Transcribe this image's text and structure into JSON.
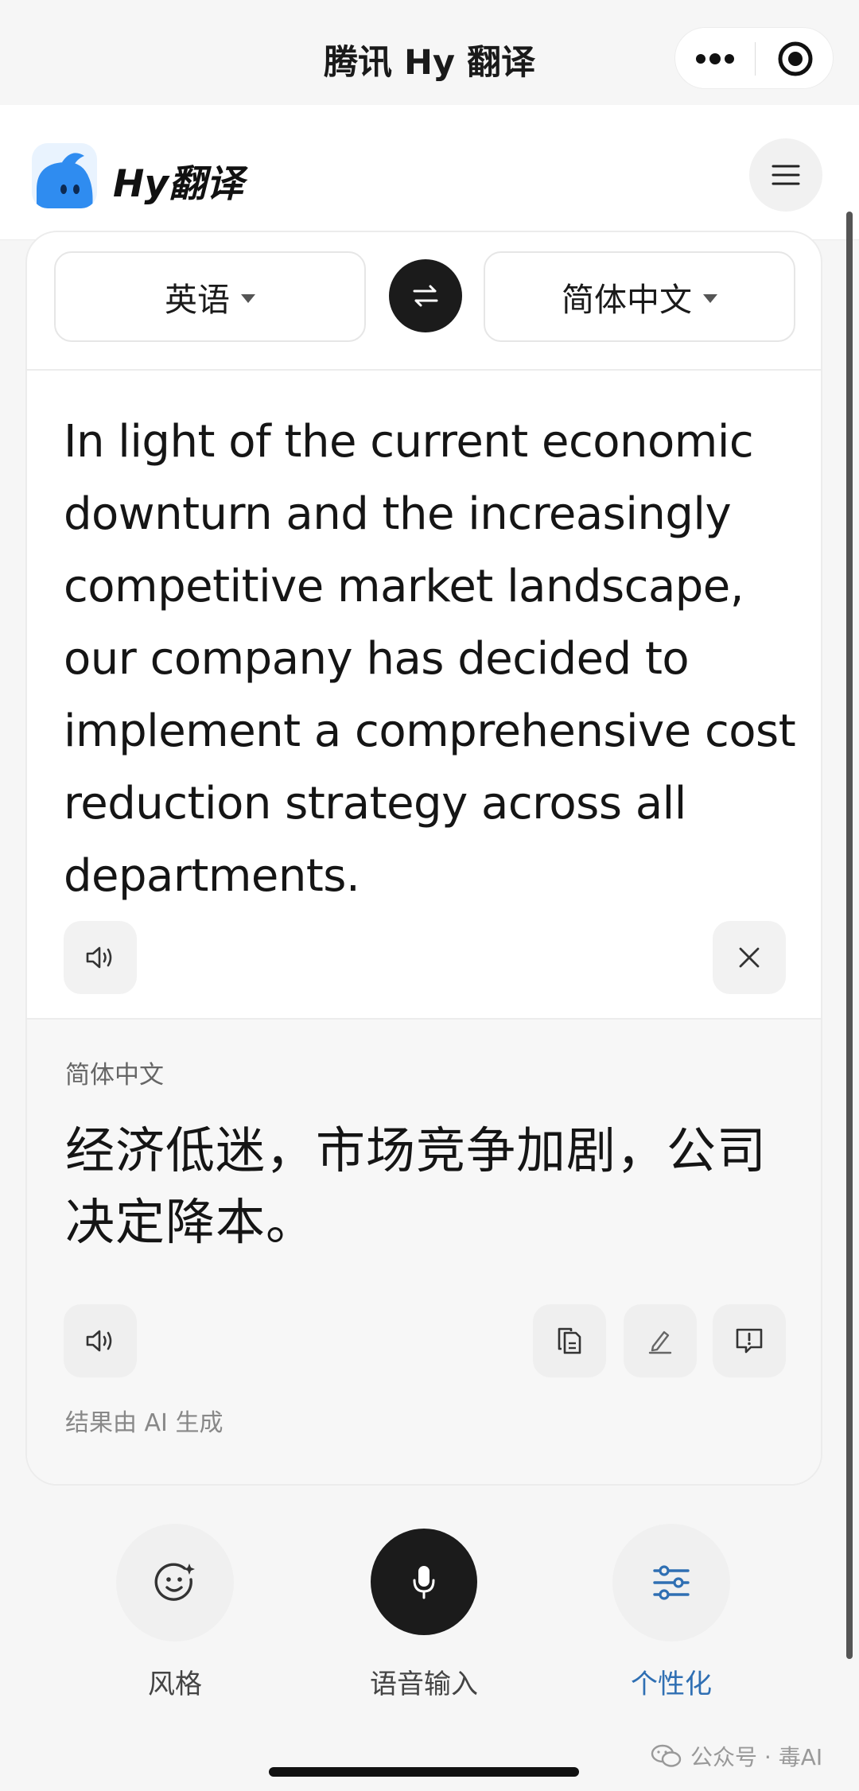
{
  "miniapp": {
    "title": "腾讯 Hy 翻译"
  },
  "header": {
    "app_name": "Hy翻译"
  },
  "languages": {
    "source": "英语",
    "target": "简体中文"
  },
  "input": {
    "text": "In light of the current economic downturn and the increasingly competitive market landscape, our company has decided to implement a comprehensive cost reduction strategy across all departments."
  },
  "output": {
    "language_label": "简体中文",
    "text": "经济低迷，市场竞争加剧，公司决定降本。",
    "ai_notice": "结果由 AI 生成"
  },
  "toolbar": {
    "style_label": "风格",
    "voice_label": "语音输入",
    "personalize_label": "个性化"
  },
  "watermark": "公众号 · 毒AI",
  "colors": {
    "accent": "#2f6fb3",
    "dark_button": "#1b1b1b",
    "logo_blue": "#2f8cf0"
  },
  "icons": [
    "more-icon",
    "target-icon",
    "menu-icon",
    "swap-icon",
    "speaker-icon",
    "close-icon",
    "copy-icon",
    "edit-icon",
    "feedback-icon",
    "smiley-icon",
    "microphone-icon",
    "sliders-icon",
    "wechat-icon"
  ]
}
